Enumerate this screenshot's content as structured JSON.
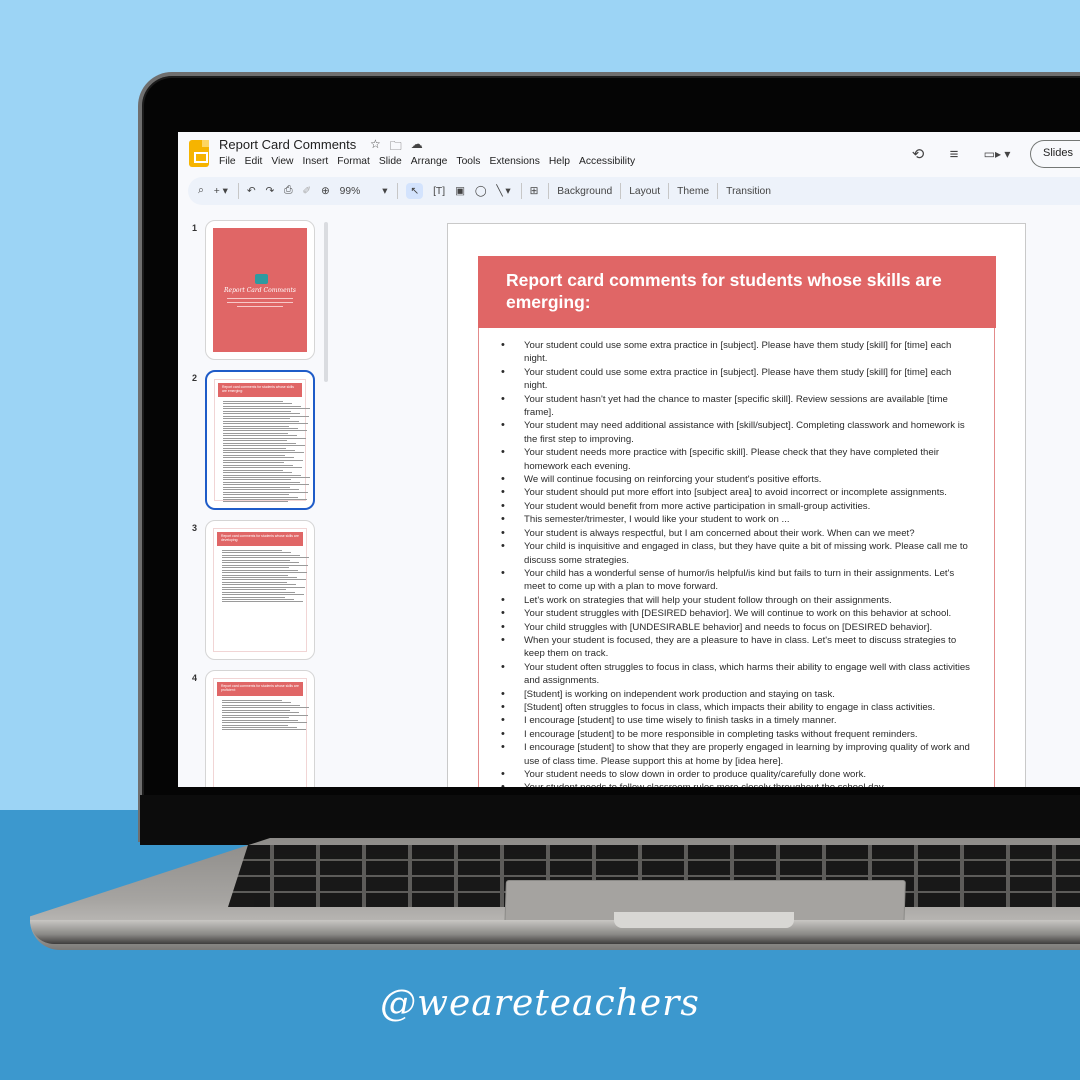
{
  "app": {
    "document_title": "Report Card Comments",
    "title_icons": [
      "star-icon",
      "move-to-folder-icon",
      "cloud-saved-icon"
    ],
    "menu": [
      "File",
      "Edit",
      "View",
      "Insert",
      "Format",
      "Slide",
      "Arrange",
      "Tools",
      "Extensions",
      "Help",
      "Accessibility"
    ],
    "right_actions": {
      "history_icon": "⟲",
      "comments_icon": "≡",
      "meet_icon": "▭▸ ▾",
      "slideshow_label": "Slides"
    }
  },
  "toolbar": {
    "search_glyph": "⌕",
    "new_slide_glyph": "+ ▾",
    "undo_glyph": "↶",
    "redo_glyph": "↷",
    "print_glyph": "⎙",
    "paint_format_glyph": "✐",
    "zoom_glyph": "⊕",
    "zoom_value": "99%",
    "zoom_dropdown": "▾",
    "select_glyph": "↖",
    "textbox_glyph": "[T]",
    "image_glyph": "▣",
    "shape_glyph": "◯",
    "line_glyph": "╲ ▾",
    "comment_glyph": "⊞",
    "background_label": "Background",
    "layout_label": "Layout",
    "theme_label": "Theme",
    "transition_label": "Transition"
  },
  "filmstrip": {
    "slides": [
      {
        "number": "1",
        "title": "Report Card Comments",
        "type": "cover"
      },
      {
        "number": "2",
        "title": "Report card comments for students whose skills are emerging:",
        "type": "list",
        "selected": true
      },
      {
        "number": "3",
        "title": "Report card comments for students whose skills are developing:",
        "type": "list"
      },
      {
        "number": "4",
        "title": "Report card comments for students whose skills are proficient:",
        "type": "list"
      }
    ]
  },
  "slide": {
    "title": "Report card comments for students whose skills are emerging:",
    "header_color": "#e06666",
    "bullets": [
      "Your student could use some extra practice in [subject]. Please have them study [skill] for [time] each night.",
      "Your student could use some extra practice in [subject]. Please have them study [skill] for [time] each night.",
      "Your student hasn't yet had the chance to master [specific skill]. Review sessions are available [time frame].",
      "Your student may need additional assistance with [skill/subject]. Completing classwork and homework is the first step to improving.",
      "Your student needs more practice with [specific skill]. Please check that they have completed their homework each evening.",
      "We will continue focusing on reinforcing your student's positive efforts.",
      "Your student should put more effort into [subject area] to avoid incorrect or incomplete assignments.",
      "Your student would benefit from more active participation in small-group activities.",
      "This semester/trimester, I would like your student to work on ...",
      "Your student is always respectful, but I am concerned about their work. When can we meet?",
      "Your child is inquisitive and engaged in class, but they have quite a bit of missing work. Please call me to discuss some strategies.",
      "Your child has a wonderful sense of humor/is helpful/is kind but fails to turn in their assignments. Let's meet to come up with a plan to move forward.",
      "Let's work on strategies that will help your student follow through on their assignments.",
      "Your student struggles with [DESIRED behavior]. We will continue to work on this behavior at school.",
      "Your child struggles with [UNDESIRABLE behavior] and needs to focus on [DESIRED behavior].",
      "When your student is focused, they are a pleasure to have in class. Let's meet to discuss strategies to keep them on track.",
      "Your student often struggles to focus in class, which harms their ability to engage well with class activities and assignments.",
      "[Student] is working on independent work production and staying on task.",
      "[Student] often struggles to focus in class, which impacts their ability to engage in class activities.",
      "I encourage [student] to use time wisely to finish tasks in a timely manner.",
      "I encourage [student] to be more responsible in completing tasks without frequent reminders.",
      "I encourage [student] to show that they are properly engaged in learning by improving quality of work and use of class time. Please support this at home by [idea here].",
      "Your student needs to slow down in order to produce quality/carefully done work.",
      "Your student needs to follow classroom rules more closely throughout the school day."
    ]
  },
  "footer": {
    "handle": "@weareteachers"
  },
  "colors": {
    "sky": "#9cd4f5",
    "floor": "#3c98ce",
    "slide_accent": "#e06666",
    "selected_thumb": "#1f5cc8"
  }
}
